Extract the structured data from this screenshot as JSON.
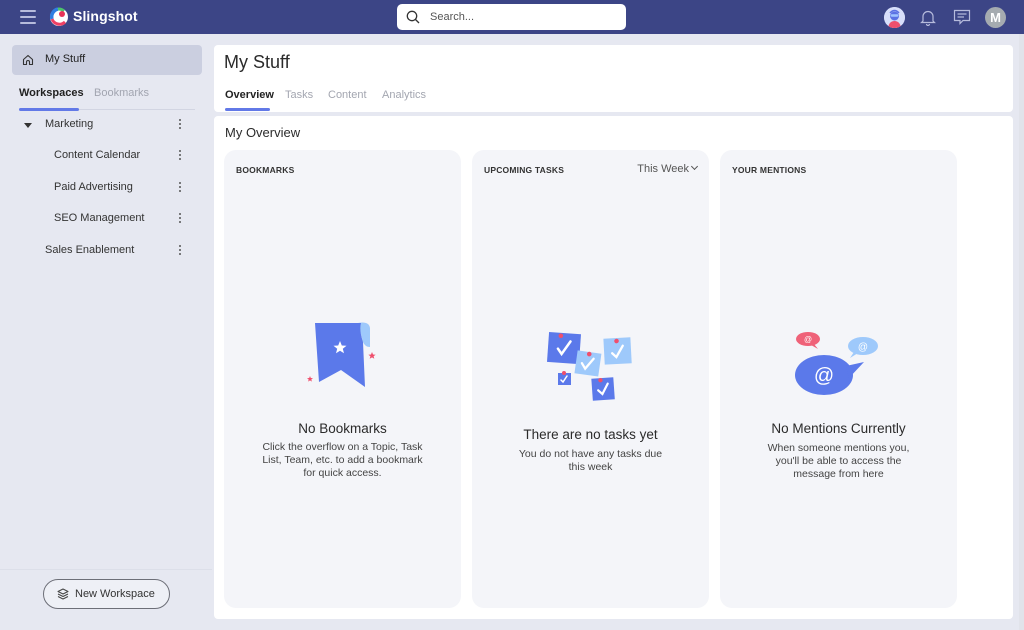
{
  "app": {
    "brand": "Slingshot",
    "search_placeholder": "Search...",
    "user_initial": "M",
    "accent_color": "#6279e7",
    "topbar_color": "#3c4586"
  },
  "sidebar": {
    "home_label": "My Stuff",
    "tabs": [
      {
        "label": "Workspaces",
        "active": true
      },
      {
        "label": "Bookmarks",
        "active": false
      }
    ],
    "tree": [
      {
        "label": "Marketing",
        "level": 0,
        "expanded": true
      },
      {
        "label": "Content Calendar",
        "level": 1
      },
      {
        "label": "Paid Advertising",
        "level": 1
      },
      {
        "label": "SEO Management",
        "level": 1
      },
      {
        "label": "Sales Enablement",
        "level": 0
      }
    ],
    "new_workspace_label": "New Workspace"
  },
  "header": {
    "title": "My Stuff",
    "tabs": [
      {
        "label": "Overview",
        "active": true
      },
      {
        "label": "Tasks",
        "active": false
      },
      {
        "label": "Content",
        "active": false
      },
      {
        "label": "Analytics",
        "active": false
      }
    ]
  },
  "overview": {
    "title": "My Overview",
    "panels": [
      {
        "title": "BOOKMARKS",
        "empty_title": "No Bookmarks",
        "empty_desc": "Click the overflow on a Topic, Task List, Team, etc. to add a bookmark for quick access."
      },
      {
        "title": "UPCOMING TASKS",
        "filter": "This Week",
        "empty_title": "There are no tasks yet",
        "empty_desc": "You do not have any tasks due this week"
      },
      {
        "title": "YOUR MENTIONS",
        "empty_title": "No Mentions Currently",
        "empty_desc": "When someone mentions you, you'll be able to access the message from here"
      }
    ]
  }
}
